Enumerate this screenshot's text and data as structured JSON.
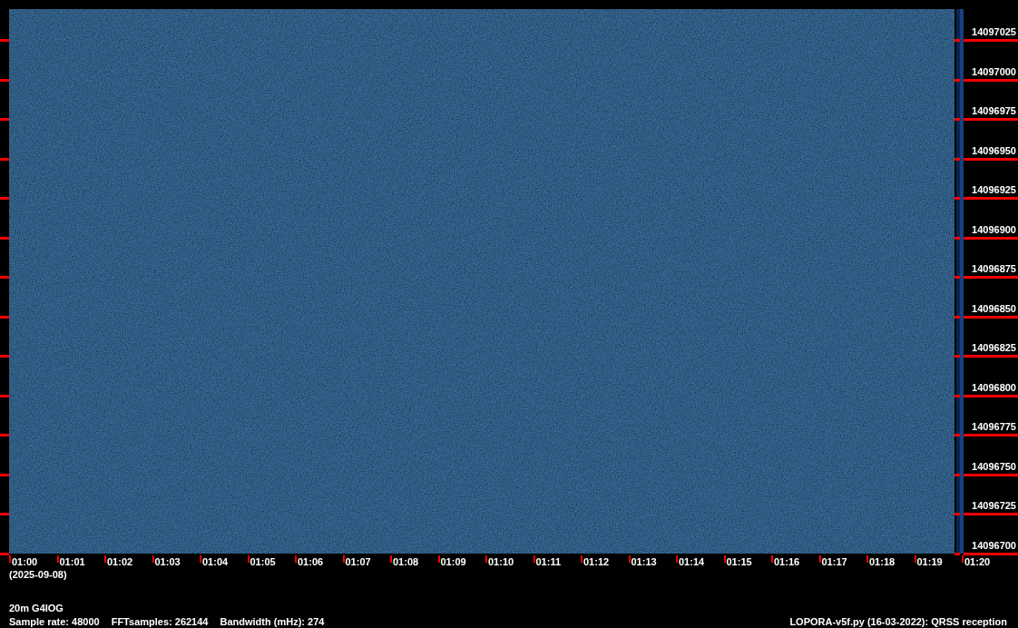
{
  "frequency_ticks": [
    "14097025",
    "14097000",
    "14096975",
    "14096950",
    "14096925",
    "14096900",
    "14096875",
    "14096850",
    "14096825",
    "14096800",
    "14096775",
    "14096750",
    "14096725",
    "14096700"
  ],
  "time_ticks": [
    "01:00",
    "01:01",
    "01:02",
    "01:03",
    "01:04",
    "01:05",
    "01:06",
    "01:07",
    "01:08",
    "01:09",
    "01:10",
    "01:11",
    "01:12",
    "01:13",
    "01:14",
    "01:15",
    "01:16",
    "01:17",
    "01:18",
    "01:19",
    "01:20"
  ],
  "date": "(2025-09-08)",
  "station": "20m G4IOG",
  "parameters": [
    "Sample rate: 48000",
    "FFTsamples: 262144",
    "Bandwidth (mHz): 274"
  ],
  "credit": "LOPORA-v5f.py (16-03-2022): QRSS reception"
}
